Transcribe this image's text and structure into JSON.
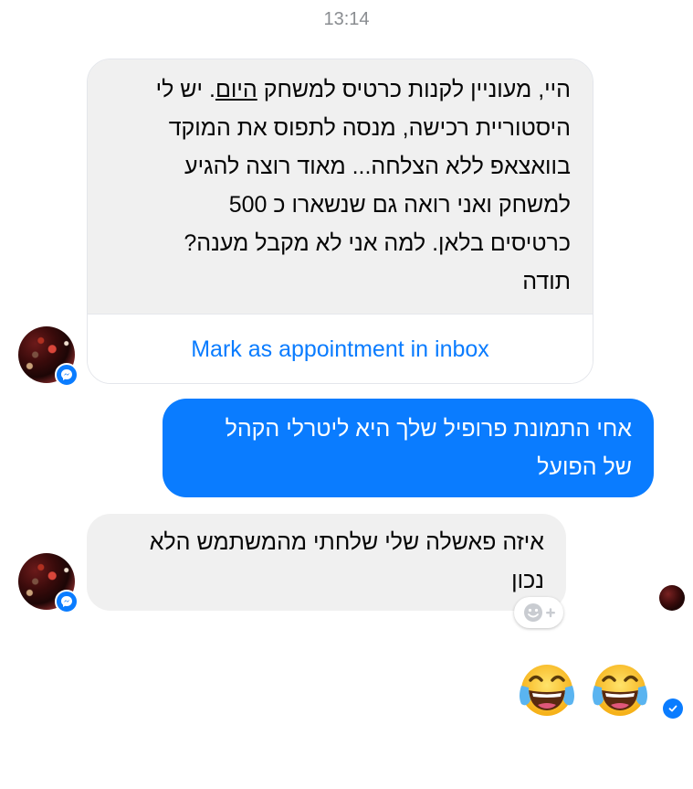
{
  "timestamp": "13:14",
  "messages": [
    {
      "sender": "other",
      "text_before": "היי, מעוניין לקנות כרטיס למשחק ",
      "text_underlined": "היום",
      "text_after": ". יש לי\nהיסטוריית רכישה, מנסה לתפוס את המוקד\nבוואצאפ ללא הצלחה... מאוד רוצה להגיע\nלמשחק ואני רואה גם שנשארו כ 500\nכרטיסים בלאן. למה אני לא מקבל מענה?\nתודה",
      "action_label": "Mark as appointment in inbox"
    },
    {
      "sender": "me",
      "text": "אחי התמונת פרופיל שלך היא ליטרלי הקהל\nשל הפועל"
    },
    {
      "sender": "other",
      "text": "איזה פאשלה שלי שלחתי מהמשתמש הלא\nנכון"
    },
    {
      "sender": "me",
      "emoji": [
        "face-with-tears-of-joy",
        "face-with-tears-of-joy"
      ]
    }
  ],
  "icons": {
    "messenger_badge": "messenger-icon",
    "react": "add-reaction-icon",
    "delivered": "check-icon"
  },
  "colors": {
    "accent": "#0a7cff",
    "incoming_bubble": "#f0f0f0",
    "timestamp": "#8a8d91"
  }
}
